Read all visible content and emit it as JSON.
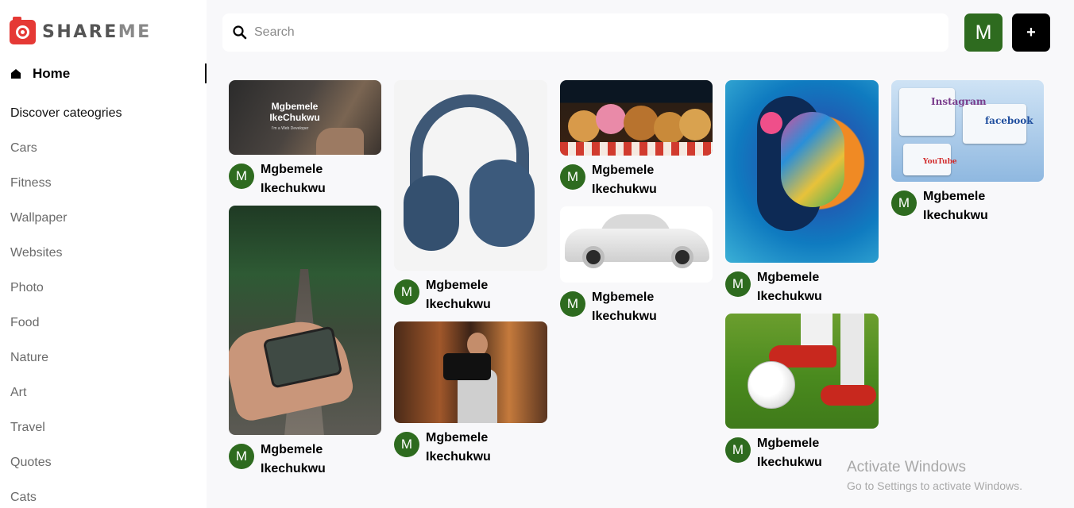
{
  "app": {
    "logo_text_a": "SHARE",
    "logo_text_b": "ME"
  },
  "sidebar": {
    "home_label": "Home",
    "discover_label": "Discover cateogries",
    "categories": [
      "Cars",
      "Fitness",
      "Wallpaper",
      "Websites",
      "Photo",
      "Food",
      "Nature",
      "Art",
      "Travel",
      "Quotes",
      "Cats"
    ]
  },
  "header": {
    "search_placeholder": "Search",
    "user_initial": "M",
    "add_label": "+"
  },
  "pins": [
    {
      "author_initial": "M",
      "author_first": "Mgbemele",
      "author_last": "Ikechukwu",
      "overlay_name": "Mgbemele IkeChukwu",
      "overlay_sub": "I'm a Web Developer"
    },
    {
      "author_initial": "M",
      "author_first": "Mgbemele",
      "author_last": "Ikechukwu"
    },
    {
      "author_initial": "M",
      "author_first": "Mgbemele",
      "author_last": "Ikechukwu"
    },
    {
      "author_initial": "M",
      "author_first": "Mgbemele",
      "author_last": "Ikechukwu"
    },
    {
      "author_initial": "M",
      "author_first": "Mgbemele",
      "author_last": "Ikechukwu"
    },
    {
      "author_initial": "M",
      "author_first": "Mgbemele",
      "author_last": "Ikechukwu"
    },
    {
      "author_initial": "M",
      "author_first": "Mgbemele",
      "author_last": "Ikechukwu"
    },
    {
      "author_initial": "M",
      "author_first": "Mgbemele",
      "author_last": "Ikechukwu"
    },
    {
      "author_initial": "M",
      "author_first": "Mgbemele",
      "author_last": "Ikechukwu",
      "brand_labels": [
        "Instagram",
        "facebook",
        "YouTube"
      ]
    }
  ],
  "watermark": {
    "title": "Activate Windows",
    "subtitle": "Go to Settings to activate Windows."
  },
  "colors": {
    "accent_green": "#2e6b1f",
    "logo_red": "#e53935"
  }
}
